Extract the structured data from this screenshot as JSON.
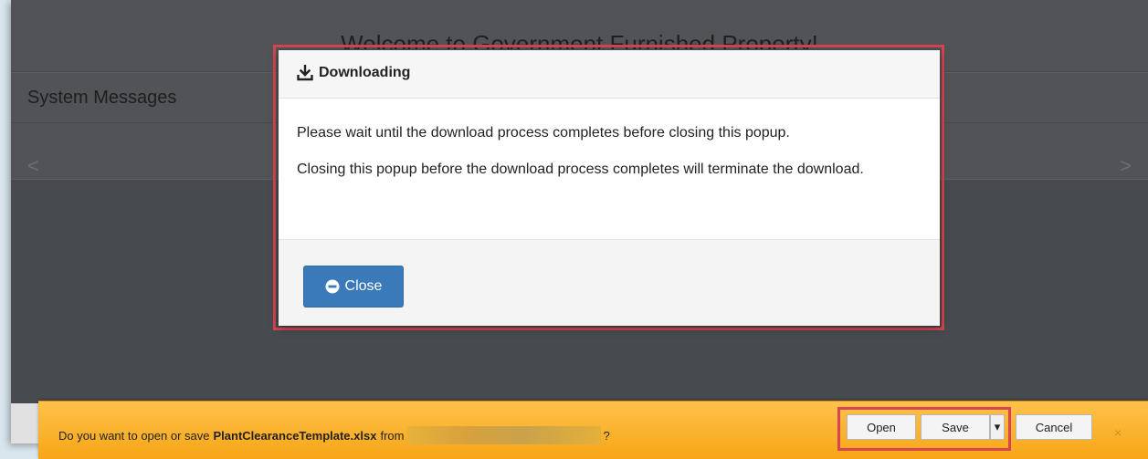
{
  "page": {
    "title": "Welcome to Government Furnished Property!",
    "system_messages_heading": "System Messages",
    "carousel_prev": "<",
    "carousel_next": ">"
  },
  "modal": {
    "icon": "download-icon",
    "title": "Downloading",
    "paragraph1": "Please wait until the download process completes before closing this popup.",
    "paragraph2": "Closing this popup before the download process completes will terminate the download.",
    "close_button_icon": "minus-circle-icon",
    "close_button_label": "Close",
    "highlight_color": "#d64551"
  },
  "download_bar": {
    "prompt_prefix": "Do you want to open or save",
    "file_name": "PlantClearanceTemplate.xlsx",
    "prompt_from": "from",
    "prompt_suffix": "?",
    "open_label": "Open",
    "save_label": "Save",
    "save_menu_glyph": "▾",
    "cancel_label": "Cancel",
    "close_glyph": "×",
    "bar_color": "#f7a616",
    "highlight_color": "#d64551"
  },
  "colors": {
    "primary_button": "#3a7ab8",
    "overlay": "#515356"
  }
}
